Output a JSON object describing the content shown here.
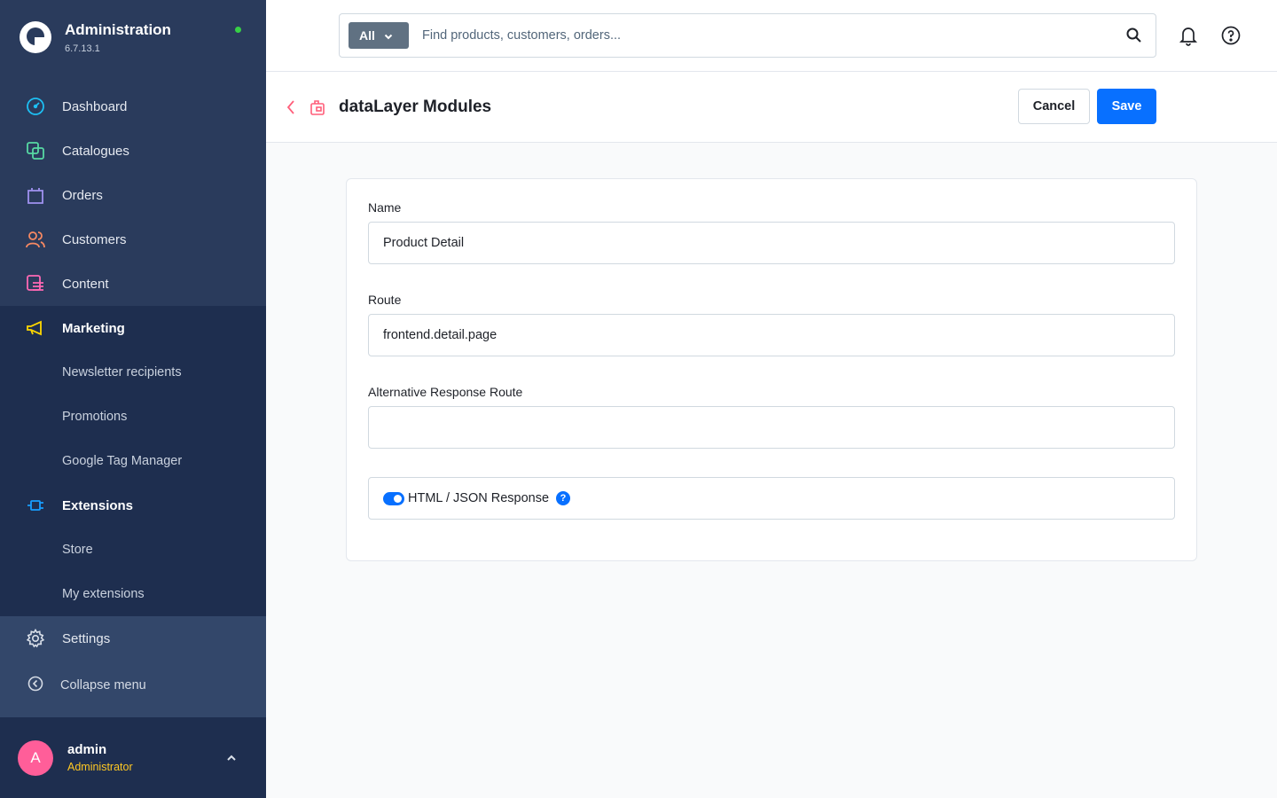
{
  "brand": {
    "title": "Administration",
    "version": "6.7.13.1"
  },
  "sidebar": {
    "items": [
      {
        "label": "Dashboard"
      },
      {
        "label": "Catalogues"
      },
      {
        "label": "Orders"
      },
      {
        "label": "Customers"
      },
      {
        "label": "Content"
      },
      {
        "label": "Marketing"
      },
      {
        "label": "Newsletter recipients"
      },
      {
        "label": "Promotions"
      },
      {
        "label": "Google Tag Manager"
      },
      {
        "label": "Extensions"
      },
      {
        "label": "Store"
      },
      {
        "label": "My extensions"
      },
      {
        "label": "Settings"
      }
    ],
    "collapse_label": "Collapse menu",
    "icon_colors": {
      "dashboard": "#1dbff3",
      "catalogues": "#57d9a3",
      "orders": "#a092f0",
      "customers": "#f88962",
      "content": "#ff68b4",
      "marketing": "#ffd700",
      "extensions": "#189eff"
    }
  },
  "user": {
    "initial": "A",
    "name": "admin",
    "role": "Administrator"
  },
  "search": {
    "type_label": "All",
    "placeholder": "Find products, customers, orders..."
  },
  "header": {
    "title": "dataLayer Modules",
    "cancel_label": "Cancel",
    "save_label": "Save"
  },
  "form": {
    "name_label": "Name",
    "name_value": "Product Detail",
    "route_label": "Route",
    "route_value": "frontend.detail.page",
    "alt_route_label": "Alternative Response Route",
    "alt_route_value": "",
    "switch_label": "HTML / JSON Response",
    "switch_on": true,
    "help_glyph": "?"
  },
  "colors": {
    "accent": "#0870ff",
    "sidebar_bg": "#2a3b5c",
    "sidebar_group_bg": "#1e2e4f",
    "avatar_bg": "#ff5e99",
    "role_color": "#ffc823",
    "status_dot": "#37d046"
  }
}
